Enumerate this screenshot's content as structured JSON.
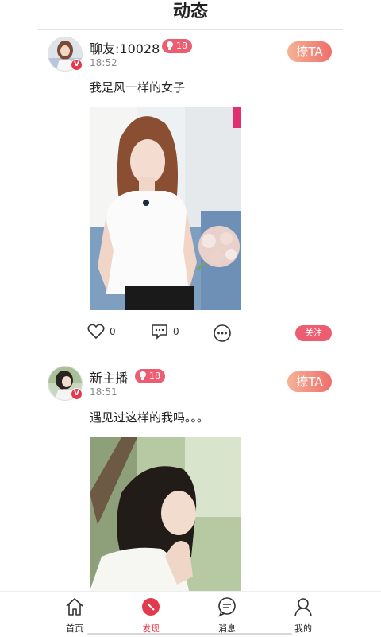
{
  "header": {
    "title": "动态"
  },
  "posts": [
    {
      "username": "聊友:10028",
      "level": "18",
      "time": "18:52",
      "liao_label": "撩TA",
      "content": "我是风一样的女子",
      "likes": "0",
      "comments": "0",
      "follow_label": "关注",
      "verified_badge": "V"
    },
    {
      "username": "新主播",
      "level": "18",
      "time": "18:51",
      "liao_label": "撩TA",
      "content": "遇见过这样的我吗。。。",
      "verified_badge": "V"
    }
  ],
  "tabbar": {
    "items": [
      {
        "label": "首页",
        "icon": "home-icon"
      },
      {
        "label": "发现",
        "icon": "compass-icon"
      },
      {
        "label": "消息",
        "icon": "message-icon"
      },
      {
        "label": "我的",
        "icon": "profile-icon"
      }
    ],
    "active_index": 1
  },
  "colors": {
    "accent": "#e23a4c",
    "badge": "#ec5d72",
    "liao_start": "#f6b297",
    "liao_end": "#ee6f6a"
  }
}
